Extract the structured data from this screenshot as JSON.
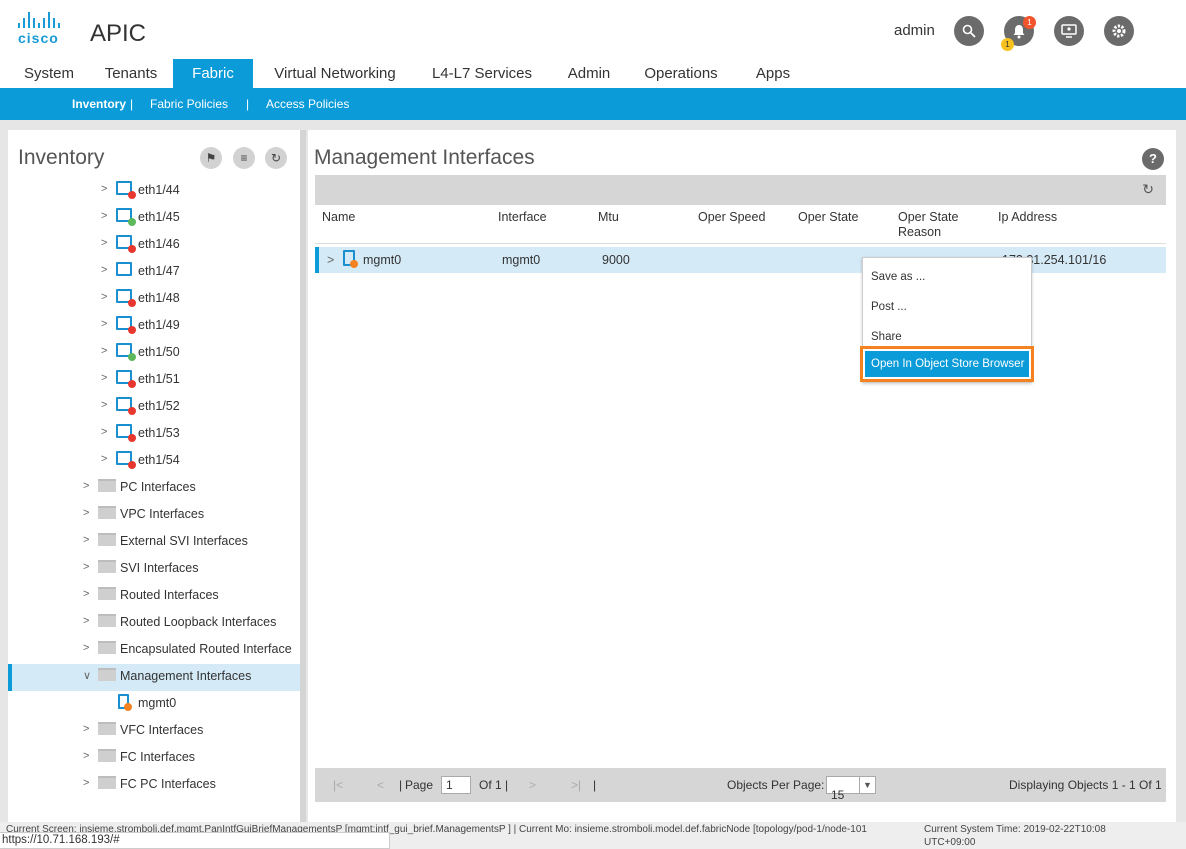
{
  "app": {
    "brand": "cisco",
    "title": "APIC",
    "user": "admin",
    "alerts_count": "1",
    "faults_count": "1"
  },
  "tabs": [
    "System",
    "Tenants",
    "Fabric",
    "Virtual Networking",
    "L4-L7 Services",
    "Admin",
    "Operations",
    "Apps"
  ],
  "subnav": {
    "items": [
      "Inventory",
      "Fabric Policies",
      "Access Policies"
    ],
    "sep": "|"
  },
  "left": {
    "title": "Inventory",
    "ports": [
      {
        "label": "eth1/44",
        "status": "red"
      },
      {
        "label": "eth1/45",
        "status": "green"
      },
      {
        "label": "eth1/46",
        "status": "red"
      },
      {
        "label": "eth1/47",
        "status": "none"
      },
      {
        "label": "eth1/48",
        "status": "red"
      },
      {
        "label": "eth1/49",
        "status": "red"
      },
      {
        "label": "eth1/50",
        "status": "green"
      },
      {
        "label": "eth1/51",
        "status": "red"
      },
      {
        "label": "eth1/52",
        "status": "red"
      },
      {
        "label": "eth1/53",
        "status": "red"
      },
      {
        "label": "eth1/54",
        "status": "red"
      }
    ],
    "folders": [
      "PC Interfaces",
      "VPC Interfaces",
      "External SVI Interfaces",
      "SVI Interfaces",
      "Routed Interfaces",
      "Routed Loopback Interfaces",
      "Encapsulated Routed Interface",
      "Management Interfaces"
    ],
    "mgmt_child": "mgmt0",
    "folders_after": [
      "VFC Interfaces",
      "FC Interfaces",
      "FC PC Interfaces"
    ]
  },
  "right": {
    "title": "Management Interfaces",
    "help": "?",
    "columns": [
      "Name",
      "Interface",
      "Mtu",
      "Oper Speed",
      "Oper State",
      "Oper State Reason",
      "Ip Address"
    ],
    "row": {
      "name": "mgmt0",
      "interface": "mgmt0",
      "mtu": "9000",
      "oper_speed": "",
      "oper_state": "",
      "ip": "172.31.254.101/16"
    },
    "context_menu": [
      "Save as ...",
      "Post ...",
      "Share",
      "Open In Object Store Browser"
    ],
    "pager": {
      "page_label": "Page",
      "page": "1",
      "of": "Of 1",
      "per_page_label": "Objects Per Page:",
      "per_page": "15",
      "displaying": "Displaying Objects 1 - 1 Of 1"
    }
  },
  "status_bar": {
    "text": "Current Screen: insieme.stromboli.def.mgmt.PanIntfGuiBriefManagementsP [mgmt:intf_gui_brief.ManagementsP ] | Current Mo: insieme.stromboli.model.def.fabricNode [topology/pod-1/node-101",
    "time": "Current System Time: 2019-02-22T10:08",
    "tz": "UTC+09:00",
    "url": "https://10.71.168.193/#"
  },
  "colors": {
    "accent": "#0a9bd8",
    "highlight": "#f58220"
  }
}
